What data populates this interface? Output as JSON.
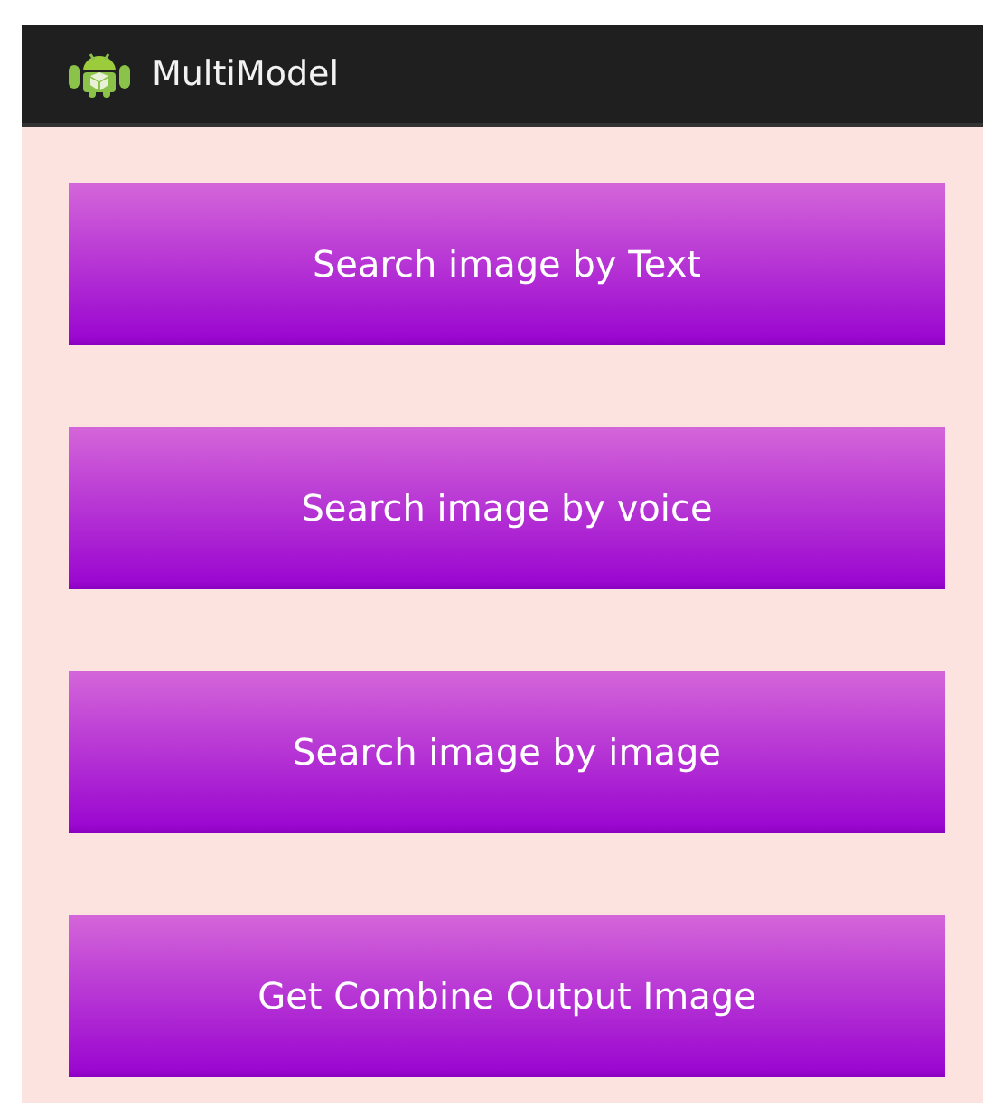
{
  "action_bar": {
    "title": "MultiModel"
  },
  "buttons": [
    "Search image by Text",
    "Search image by voice",
    "Search image by image",
    "Get Combine Output Image"
  ]
}
